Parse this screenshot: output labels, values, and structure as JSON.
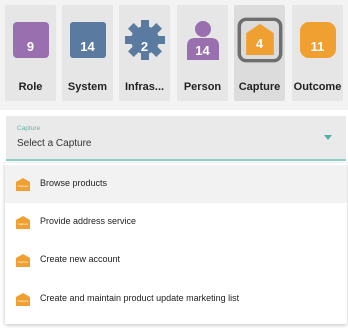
{
  "tiles": [
    {
      "label": "Role",
      "count": "9",
      "color": "#9a6fb0",
      "icon": "square-icon"
    },
    {
      "label": "System",
      "count": "14",
      "color": "#5b7aa0",
      "icon": "square-icon"
    },
    {
      "label": "Infras...",
      "count": "2",
      "color": "#5b7aa0",
      "icon": "gear-icon"
    },
    {
      "label": "Person",
      "count": "14",
      "color": "#9a6fb0",
      "icon": "person-icon"
    },
    {
      "label": "Capture",
      "count": "4",
      "color": "#f0a030",
      "icon": "capture-icon",
      "selected": true
    },
    {
      "label": "Outcome",
      "count": "11",
      "color": "#f0a030",
      "icon": "rounded-square-icon"
    }
  ],
  "select": {
    "label": "Capture",
    "placeholder": "Select a Capture"
  },
  "options": [
    {
      "text": "Browse products"
    },
    {
      "text": "Provide address service"
    },
    {
      "text": "Create new account"
    },
    {
      "text": "Create and maintain product update marketing list"
    }
  ],
  "option_icon_text": "Capture"
}
